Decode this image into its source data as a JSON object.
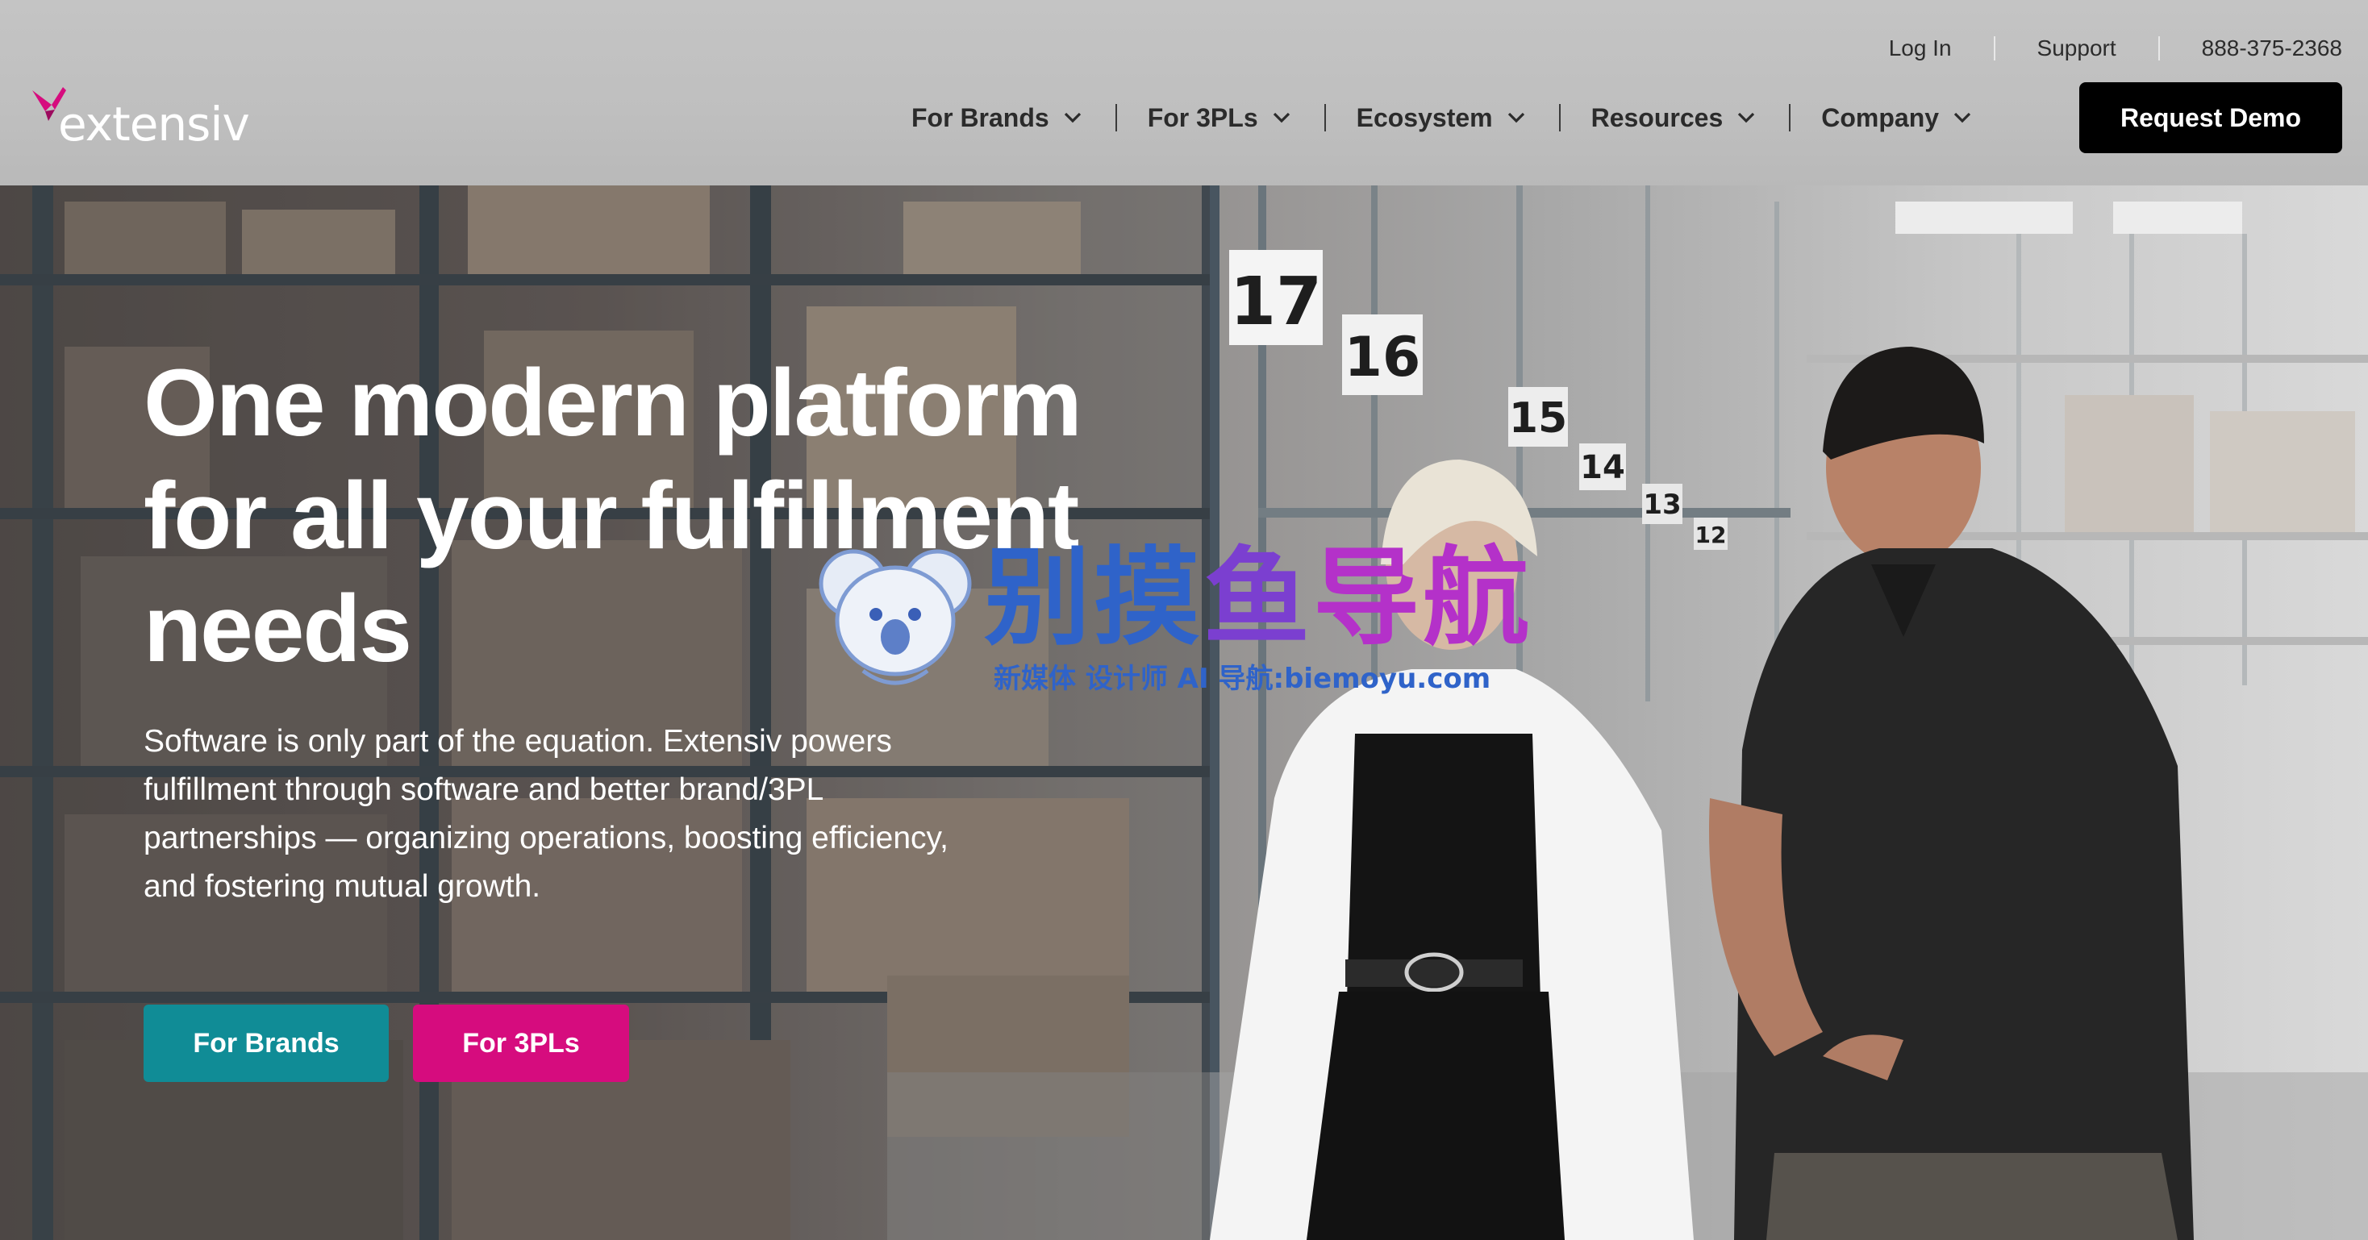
{
  "brand": {
    "name": "extensiv",
    "accent": "#d60c7e",
    "teal": "#108c96"
  },
  "utility_nav": {
    "login": "Log In",
    "support": "Support",
    "phone": "888-375-2368"
  },
  "main_nav": {
    "items": [
      {
        "label": "For Brands",
        "icon": "chevron-down-icon"
      },
      {
        "label": "For 3PLs",
        "icon": "chevron-down-icon"
      },
      {
        "label": "Ecosystem",
        "icon": "chevron-down-icon"
      },
      {
        "label": "Resources",
        "icon": "chevron-down-icon"
      },
      {
        "label": "Company",
        "icon": "chevron-down-icon"
      }
    ],
    "cta": "Request Demo"
  },
  "hero": {
    "title_lines": [
      "One modern platform",
      "for all your fulfillment",
      "needs"
    ],
    "subtitle": "Software is only part of the equation. Extensiv powers fulfillment through software and better brand/3PL partnerships — organizing operations, boosting efficiency, and fostering mutual growth.",
    "buttons": {
      "brands": "For Brands",
      "threepls": "For 3PLs"
    },
    "aisle_numbers": [
      "17",
      "16",
      "15",
      "14",
      "13",
      "12"
    ]
  },
  "watermark": {
    "title_a": "别摸",
    "title_b": "鱼",
    "title_c": "导航",
    "subtitle": "新媒体 设计师 AI 导航:biemoyu.com"
  }
}
